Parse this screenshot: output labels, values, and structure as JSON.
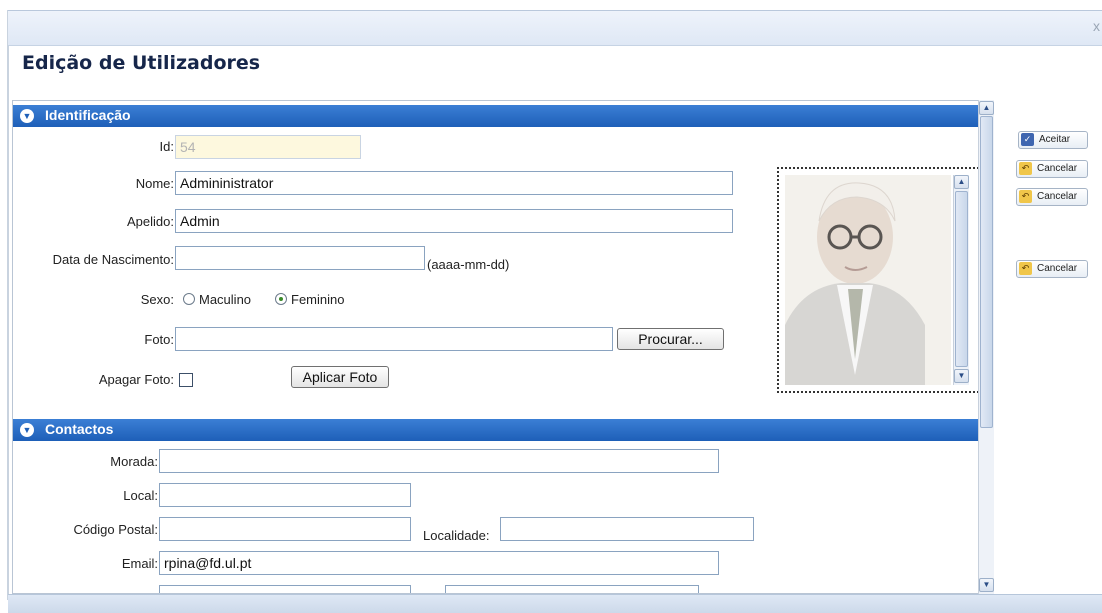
{
  "window": {
    "close_symbol": "x",
    "title": "Edição de Utilizadores"
  },
  "identificacao": {
    "header": "Identificação",
    "id_label": "Id:",
    "id_value": "54",
    "nome_label": "Nome:",
    "nome_value": "Admininistrator",
    "apelido_label": "Apelido:",
    "apelido_value": "Admin",
    "nascimento_label": "Data de Nascimento:",
    "nascimento_value": "",
    "nascimento_hint": "(aaaa-mm-dd)",
    "sexo_label": "Sexo:",
    "sexo_options": [
      "Maculino",
      "Feminino"
    ],
    "sexo_selected": "Feminino",
    "foto_label": "Foto:",
    "foto_value": "",
    "procurar_label": "Procurar...",
    "apagar_label": "Apagar Foto:",
    "apagar_checked": false,
    "aplicar_label": "Aplicar Foto"
  },
  "contactos": {
    "header": "Contactos",
    "morada_label": "Morada:",
    "morada_value": "",
    "local_label": "Local:",
    "local_value": "",
    "postal_label": "Código Postal:",
    "postal_value": "",
    "localidade_label": "Localidade:",
    "localidade_value": "",
    "email_label": "Email:",
    "email_value": "rpina@fd.ul.pt"
  },
  "actions": {
    "aceitar": "Aceitar",
    "cancelar_1": "Cancelar",
    "cancelar_2": "Cancelar",
    "cancelar_3": "Cancelar"
  },
  "icons": {
    "aceitar": "check-icon",
    "cancelar": "undo-arrow-icon",
    "collapse": "chevron-down-icon"
  },
  "colors": {
    "header_blue": "#1e5fb8",
    "title_navy": "#16264a",
    "readonly_field": "#fdf8de"
  }
}
